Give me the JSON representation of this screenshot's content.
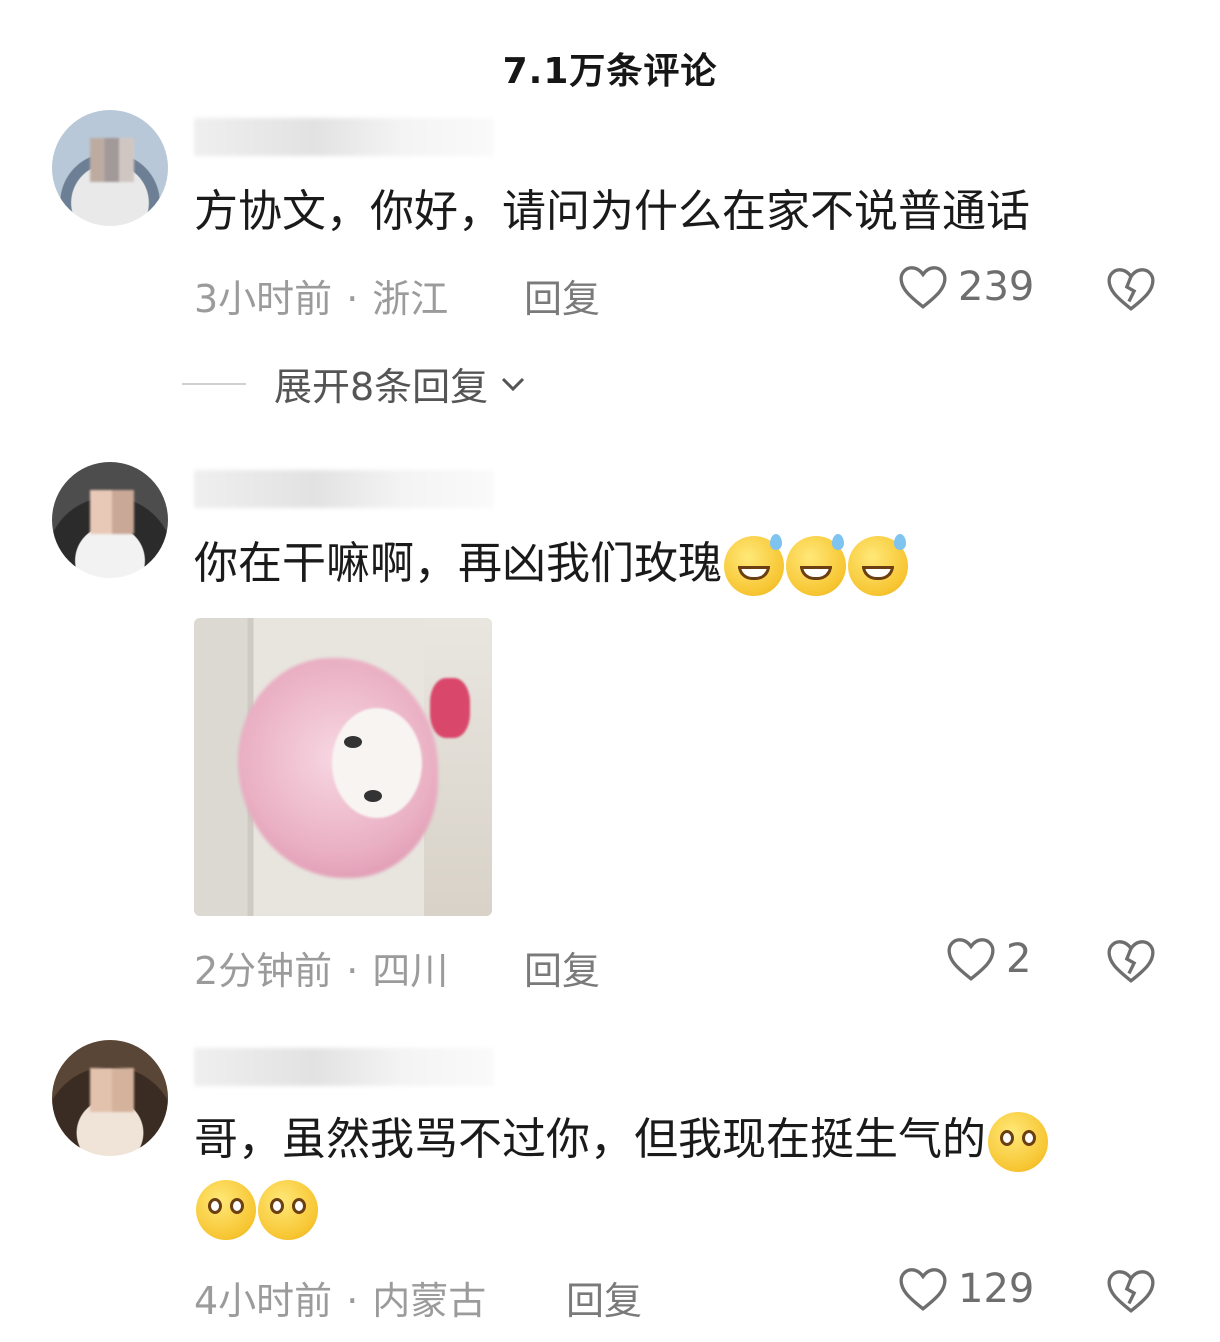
{
  "header": {
    "title": "7.1万条评论"
  },
  "comments": [
    {
      "text": "方协文，你好，请问为什么在家不说普通话",
      "time": "3小时前",
      "location": "浙江",
      "reply_label": "回复",
      "likes": "239",
      "expand_label": "展开8条回复"
    },
    {
      "text": "你在干嘛啊，再凶我们玫瑰",
      "emoji": [
        "grin-sweat-emoji",
        "grin-sweat-emoji",
        "grin-sweat-emoji"
      ],
      "time": "2分钟前",
      "location": "四川",
      "reply_label": "回复",
      "likes": "2"
    },
    {
      "text": "哥，虽然我骂不过你，但我现在挺生气的",
      "emoji": [
        "smile-emoji",
        "smile-emoji",
        "smile-emoji"
      ],
      "time": "4小时前",
      "location": "内蒙古",
      "reply_label": "回复",
      "likes": "129"
    }
  ],
  "meta_separator": "·",
  "icons": {
    "like": "heart-outline-icon",
    "dislike": "broken-heart-icon",
    "expand": "chevron-down-icon"
  },
  "colors": {
    "text": "#1a1a1a",
    "meta": "#9b9b9b",
    "reply": "#7a7a7a"
  }
}
